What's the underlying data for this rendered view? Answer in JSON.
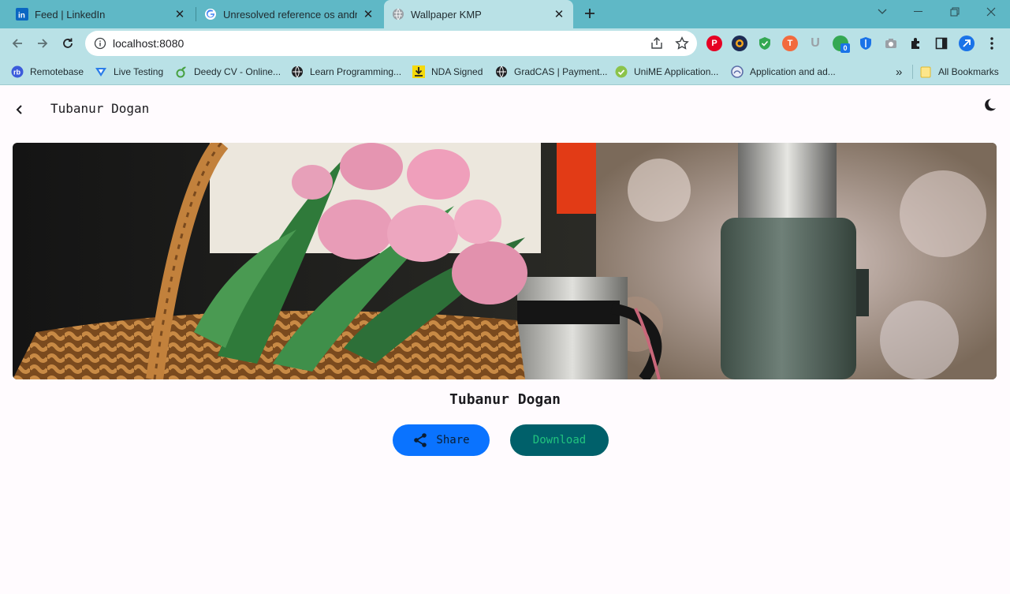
{
  "browser": {
    "tabs": [
      {
        "title": "Feed | LinkedIn",
        "icon": "linkedin-icon"
      },
      {
        "title": "Unresolved reference os android",
        "icon": "google-icon"
      },
      {
        "title": "Wallpaper KMP",
        "icon": "globe-icon"
      }
    ],
    "url": "localhost:8080",
    "bookmarks": [
      {
        "label": "Remotebase",
        "icon": "remotebase-icon"
      },
      {
        "label": "Live Testing",
        "icon": "live-testing-icon"
      },
      {
        "label": "Deedy CV - Online...",
        "icon": "overleaf-icon"
      },
      {
        "label": "Learn Programming...",
        "icon": "globe-icon"
      },
      {
        "label": "NDA Signed",
        "icon": "download-icon"
      },
      {
        "label": "GradCAS | Payment...",
        "icon": "globe-icon"
      },
      {
        "label": "UniME Application...",
        "icon": "check-icon"
      },
      {
        "label": "Application and ad...",
        "icon": "application-icon"
      }
    ],
    "bookmarks_overflow": "»",
    "all_bookmarks": "All Bookmarks",
    "ext_badge": "0"
  },
  "app": {
    "title": "Tubanur Dogan",
    "author": "Tubanur Dogan",
    "share_label": "Share",
    "download_label": "Download",
    "image_alt": "Wallpaper photo: basket of pink tulips beside a green Stanley thermos"
  },
  "colors": {
    "tabstrip": "#5fb8c6",
    "toolbar": "#b9e1e6",
    "share_bg": "#0a73ff",
    "download_bg": "#00606a",
    "download_text": "#21c37e"
  }
}
